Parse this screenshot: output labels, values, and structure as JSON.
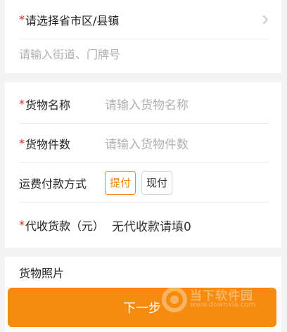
{
  "address": {
    "region_required": "*",
    "region_placeholder": "请选择省市区/县镇",
    "street_placeholder": "请输入街道、门牌号"
  },
  "goods": {
    "name_required": "*",
    "name_label": "货物名称",
    "name_placeholder": "请输入货物名称",
    "count_required": "*",
    "count_label": "货物件数",
    "count_placeholder": "请输入货物件数",
    "payment_label": "运费付款方式",
    "payment_options": [
      "提付",
      "现付"
    ],
    "payment_selected": "提付",
    "cod_required": "*",
    "cod_label": "代收货款（元）",
    "cod_placeholder": "无代收款请填0"
  },
  "photo": {
    "label": "货物照片"
  },
  "footer": {
    "next_label": "下一步"
  },
  "watermark": {
    "title": "当下软件园",
    "url": "www.downxia.com"
  },
  "colors": {
    "accent": "#f68c0f",
    "required": "#e2231a",
    "placeholder": "#b0b0b0"
  }
}
